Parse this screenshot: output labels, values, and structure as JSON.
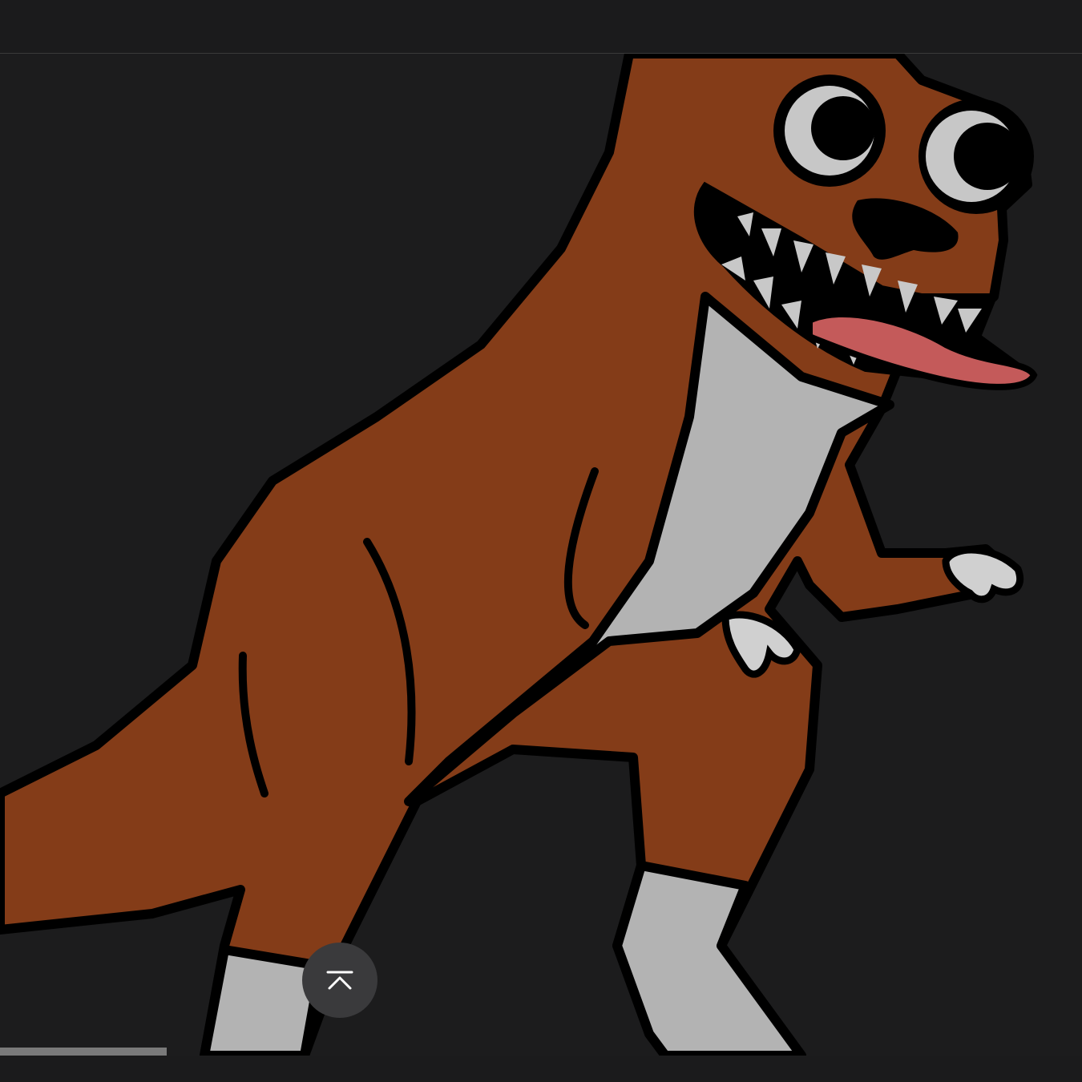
{
  "viewer": {
    "image_subject": "cartoon-dinosaur",
    "colors": {
      "background": "#1c1c1d",
      "body": "#843c18",
      "belly": "#b3b3b3",
      "tongue": "#c45a5a",
      "outline": "#000000"
    }
  },
  "controls": {
    "scroll_top_icon": "chevron-up-to-top-icon"
  },
  "playback": {
    "progress_fraction": 0.154
  }
}
